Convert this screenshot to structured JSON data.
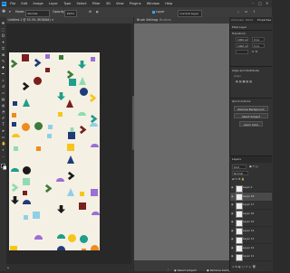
{
  "app": {
    "logo": "Ps"
  },
  "menubar": {
    "items": [
      "File",
      "Edit",
      "Image",
      "Layer",
      "Type",
      "Select",
      "Filter",
      "3D",
      "View",
      "Plugins",
      "Window",
      "Help"
    ]
  },
  "options_bar": {
    "mode_label": "Mode:",
    "mode_value": "Normal",
    "opacity_label": "Opacity:",
    "opacity_value": "100%",
    "auto_select_label": "Layer",
    "sample_label": "Current Layer"
  },
  "document": {
    "tab_title": "Untitled-1 @ 33.3% (RGB/8#)"
  },
  "middle_panel": {
    "tabs": [
      "Brush Settings",
      "Brushes"
    ],
    "select_subject": "Select subject",
    "remove_background": "Remove background"
  },
  "right_panel": {
    "tabs": [
      "Channels",
      "Paths",
      "Properties"
    ],
    "pixel_layer_label": "Pixel Layer",
    "transform_label": "Transform",
    "w_value": "1000 px",
    "h_value": "1000 px",
    "x_value": "0 px",
    "y_value": "0 px",
    "align_label": "Align and Distribute",
    "align_sub": "Align:",
    "quick_actions_label": "Quick Actions",
    "remove_bg_btn": "Remove Background",
    "select_subject_btn": "Select Subject",
    "more_btn": "Learn more",
    "layers_tab": "Layers",
    "kind_label": "Kind",
    "normal_label": "Normal",
    "layers": [
      "Layer 2",
      "Layer 18",
      "Layer 17",
      "Layer 16",
      "Layer 15",
      "Layer 14",
      "Layer 13",
      "Layer 12",
      "Layer 11"
    ]
  },
  "colors": {
    "accent": "#31a8ff",
    "artboard_bg": "#f5f0e4",
    "navy": "#1f3c78",
    "green": "#3f7a3a",
    "teal": "#1f9e8a",
    "orange": "#f08a1c",
    "yellow": "#f7c51a",
    "purple": "#9b6fd6",
    "lightblue": "#8fd0e6",
    "mint": "#8fdcb2",
    "maroon": "#7a1e1e",
    "black": "#1a1a1a"
  }
}
